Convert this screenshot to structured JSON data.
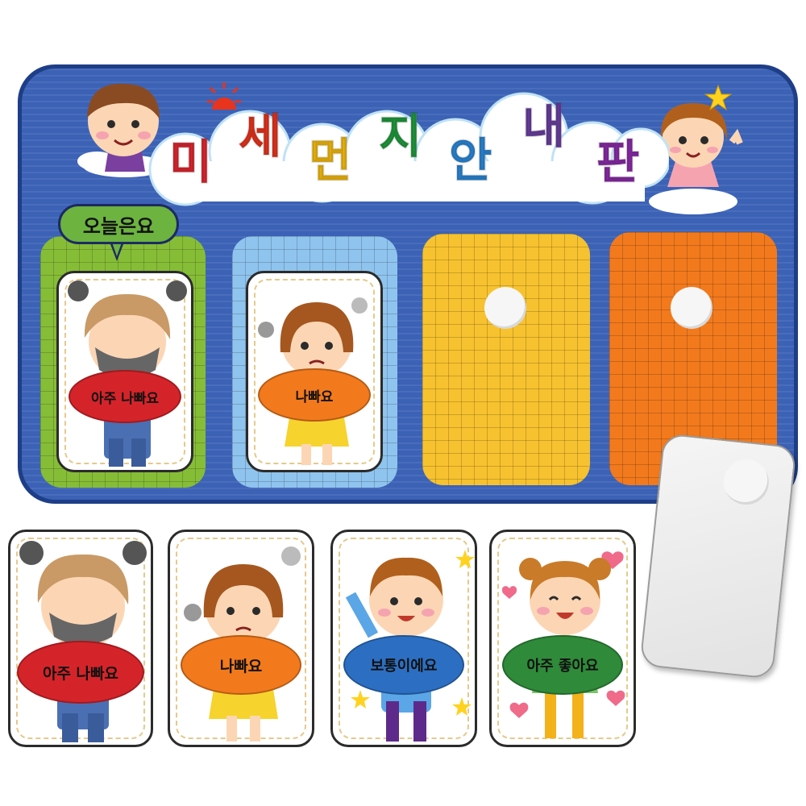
{
  "board": {
    "title_letters": [
      "미",
      "세",
      "먼",
      "지",
      "안",
      "내",
      "판"
    ],
    "title_colors": [
      "#e02630",
      "#e8331d",
      "#f2b90f",
      "#1f9a3c",
      "#2b86d6",
      "#6a3fa0",
      "#8a2aa8"
    ],
    "today_label": "오늘은요",
    "slot_colors": [
      "#86bd37",
      "#8fc4ee",
      "#f7c22f",
      "#f27a1d"
    ]
  },
  "board_cards": [
    {
      "label": "아주 나빠요",
      "oval_color": "#d4242a",
      "theme": "masked-kid"
    },
    {
      "label": "나빠요",
      "oval_color": "#f27a1d",
      "theme": "worried-girl"
    }
  ],
  "cards": [
    {
      "label": "아주 나빠요",
      "oval_color": "#d4242a",
      "theme": "masked-kid"
    },
    {
      "label": "나빠요",
      "oval_color": "#f27a1d",
      "theme": "worried-girl"
    },
    {
      "label": "보통이에요",
      "oval_color": "#2c6fc2",
      "theme": "waving-boy"
    },
    {
      "label": "아주 좋아요",
      "oval_color": "#2f8a3a",
      "theme": "happy-girl"
    }
  ],
  "icons": [
    "sun-icon",
    "star-icon",
    "angry-cloud-icon",
    "smoke-puff-icon",
    "heart-icon"
  ]
}
